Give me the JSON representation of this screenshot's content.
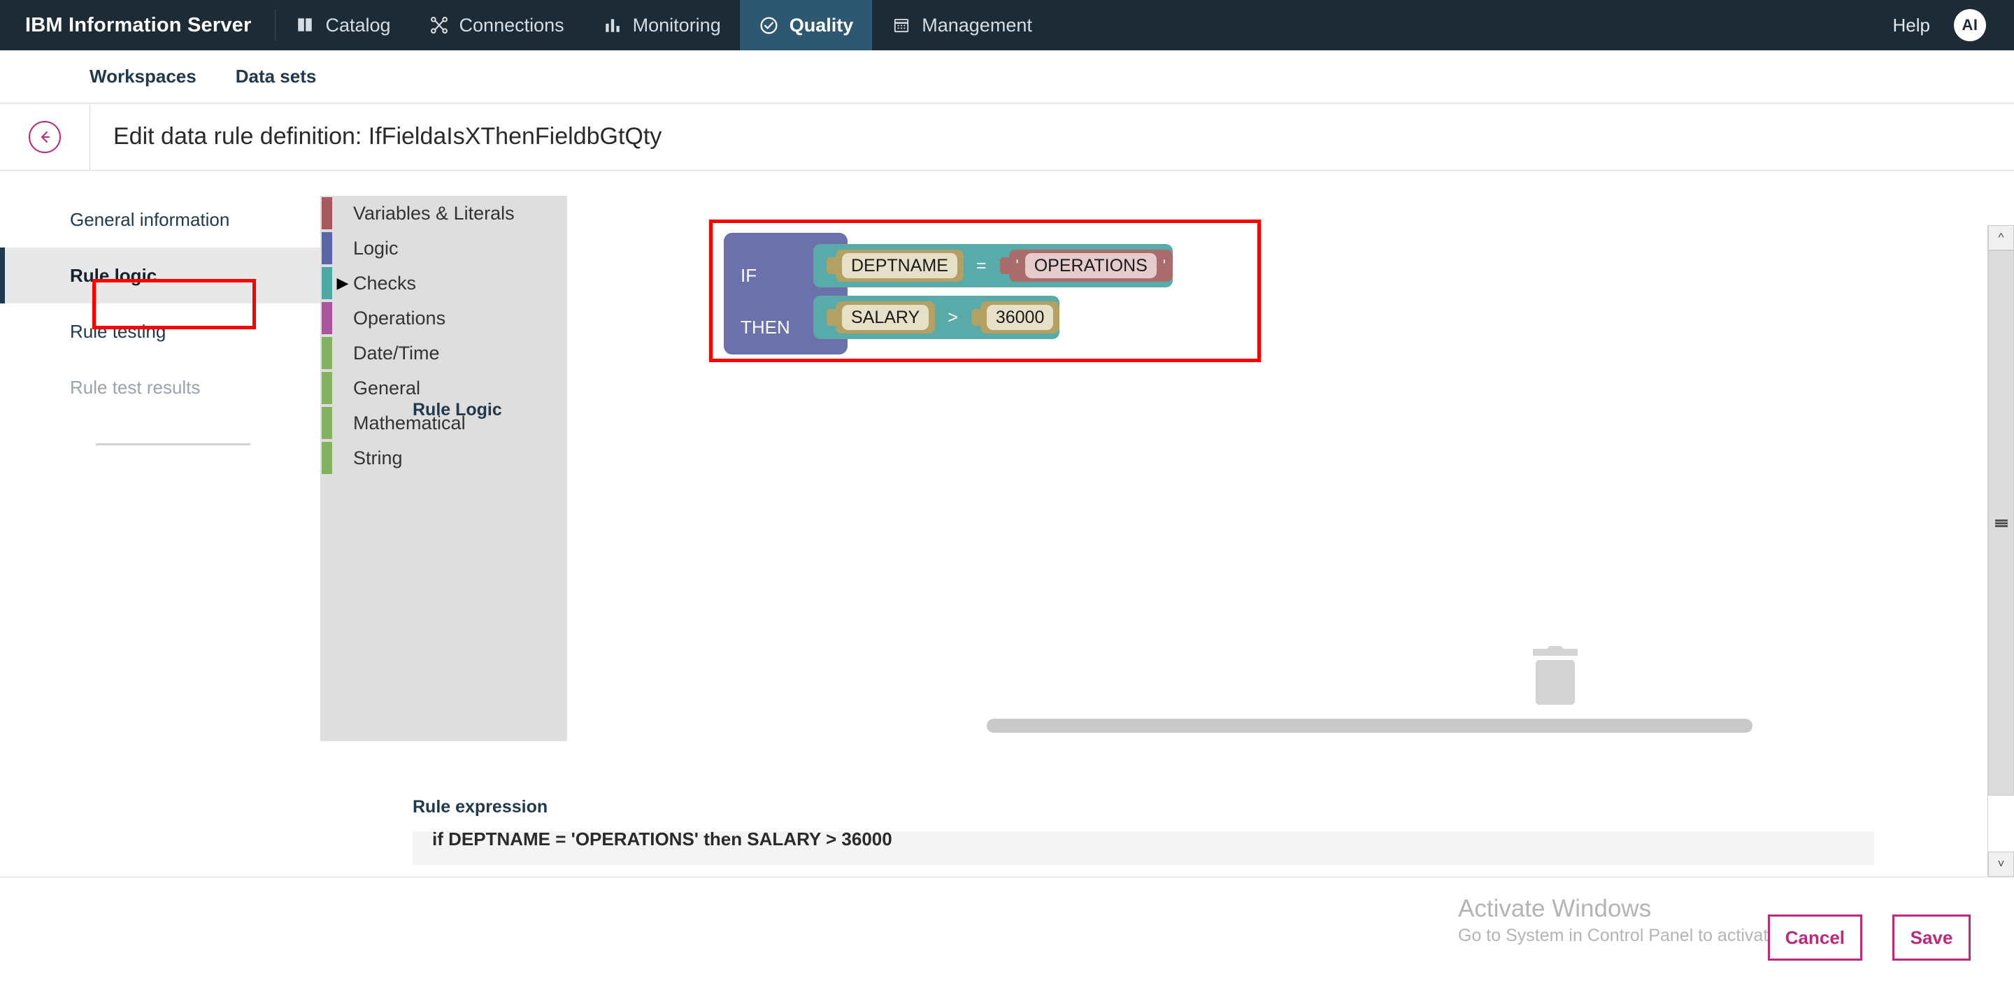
{
  "header": {
    "brand": "IBM Information Server",
    "tabs": [
      {
        "label": "Catalog",
        "icon": "book-icon",
        "active": false
      },
      {
        "label": "Connections",
        "icon": "nodes-icon",
        "active": false
      },
      {
        "label": "Monitoring",
        "icon": "bar-chart-icon",
        "active": false
      },
      {
        "label": "Quality",
        "icon": "check-circle-icon",
        "active": true
      },
      {
        "label": "Management",
        "icon": "calendar-icon",
        "active": false
      }
    ],
    "help_label": "Help",
    "avatar_initials": "AI"
  },
  "subnav": {
    "items": [
      {
        "label": "Workspaces"
      },
      {
        "label": "Data sets"
      }
    ]
  },
  "page": {
    "back_icon": "arrow-left-circle-icon",
    "title": "Edit data rule definition: IfFieldaIsXThenFieldbGtQty"
  },
  "left_nav": {
    "items": [
      {
        "label": "General information",
        "state": "default"
      },
      {
        "label": "Rule logic",
        "state": "selected"
      },
      {
        "label": "Rule testing",
        "state": "default"
      },
      {
        "label": "Rule test results",
        "state": "disabled"
      }
    ]
  },
  "palette": {
    "title": "Rule Logic",
    "items": [
      {
        "label": "Variables & Literals",
        "color": "#a8595e",
        "expanded": false
      },
      {
        "label": "Logic",
        "color": "#5a66a5",
        "expanded": false
      },
      {
        "label": "Checks",
        "color": "#4fa8a6",
        "expanded": true
      },
      {
        "label": "Operations",
        "color": "#a9559b",
        "expanded": false
      },
      {
        "label": "Date/Time",
        "color": "#84b263",
        "expanded": false
      },
      {
        "label": "General",
        "color": "#84b263",
        "expanded": false
      },
      {
        "label": "Mathematical",
        "color": "#84b263",
        "expanded": false
      },
      {
        "label": "String",
        "color": "#84b263",
        "expanded": false
      }
    ]
  },
  "canvas": {
    "trash_icon": "trash-icon",
    "rule_blocks": {
      "container_color": "#6b71ab",
      "check_color": "#58aba9",
      "variable_color": "#b3a164",
      "literal_color": "#a96b6b",
      "if_label": "IF",
      "then_label": "THEN",
      "if_row": {
        "left_operand": "DEPTNAME",
        "operator": "=",
        "right_literal": "OPERATIONS",
        "quote": "'"
      },
      "then_row": {
        "left_operand": "SALARY",
        "operator": ">",
        "right_operand": "36000"
      }
    }
  },
  "rule_expression": {
    "title": "Rule expression",
    "text": "if DEPTNAME = 'OPERATIONS' then SALARY > 36000"
  },
  "watermark": {
    "line1": "Activate Windows",
    "line2": "Go to System in Control Panel to activate Windows."
  },
  "footer": {
    "cancel_label": "Cancel",
    "save_label": "Save",
    "accent_color": "#bb2a7b"
  }
}
